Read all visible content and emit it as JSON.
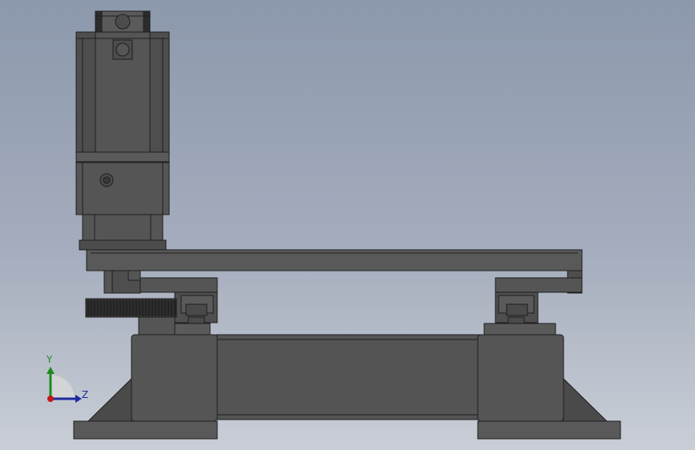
{
  "viewport": {
    "background_top": "#8c98ac",
    "background_bottom": "#c9ced6"
  },
  "model": {
    "body_color": "#555555",
    "edge_color": "#1e1e1e"
  },
  "triad": {
    "y_label": "Y",
    "z_label": "Z",
    "y_color": "#1e8a1e",
    "z_color": "#1c2a9e",
    "x_color": "#c41818"
  }
}
